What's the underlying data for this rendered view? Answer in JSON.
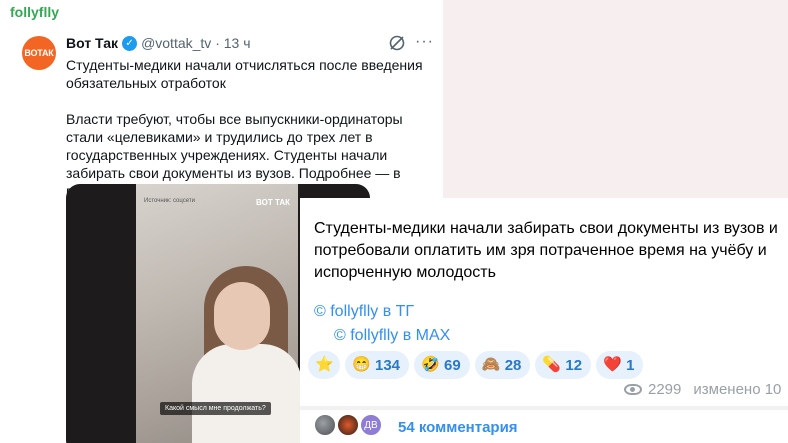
{
  "channel_name": "follyflly",
  "tweet": {
    "avatar_text": "ВОТАК",
    "author_name": "Вот Так",
    "meta": "@vottak_tv · 13 ч",
    "more": "···",
    "paragraphs": [
      "Студенты-медики начали отчисляться после введения обязательных отработок",
      "Власти требуют, чтобы все выпускники-ординаторы стали «целевиками» и трудились до трех лет в государственных учреждениях. Студенты начали забирать свои документы из вузов. Подробнее — в видео."
    ],
    "video": {
      "source_label": "Источник: соцсети",
      "logo": "ВОТ ТАК",
      "caption": "Какой смысл мне продолжать?"
    }
  },
  "telegram_message": {
    "text": "Студенты-медики начали забирать свои документы из вузов и потребовали оплатить им зря потраченное время на учёбу и испорченную молодость",
    "links": [
      {
        "label": "© follyflly в ТГ"
      },
      {
        "label": "© follyflly в MAX"
      }
    ],
    "reactions": [
      {
        "emoji": "⭐",
        "count": "",
        "icon": "star-icon"
      },
      {
        "emoji": "😁",
        "count": "134",
        "icon": "grin-icon"
      },
      {
        "emoji": "🤣",
        "count": "69",
        "icon": "rofl-icon"
      },
      {
        "emoji": "🙈",
        "count": "28",
        "icon": "monkey-icon"
      },
      {
        "emoji": "💊",
        "count": "12",
        "icon": "pill-icon"
      },
      {
        "emoji": "❤️",
        "count": "1",
        "icon": "heart-icon"
      }
    ],
    "views": "2299",
    "edited": "изменено 10",
    "comments": {
      "third_avatar_initials": "ДВ",
      "label": "54 комментария"
    }
  },
  "colors": {
    "brand_orange": "#f26522",
    "link_blue": "#3390ec",
    "reaction_bg": "#e6f1fc",
    "header_green": "#34a853"
  }
}
